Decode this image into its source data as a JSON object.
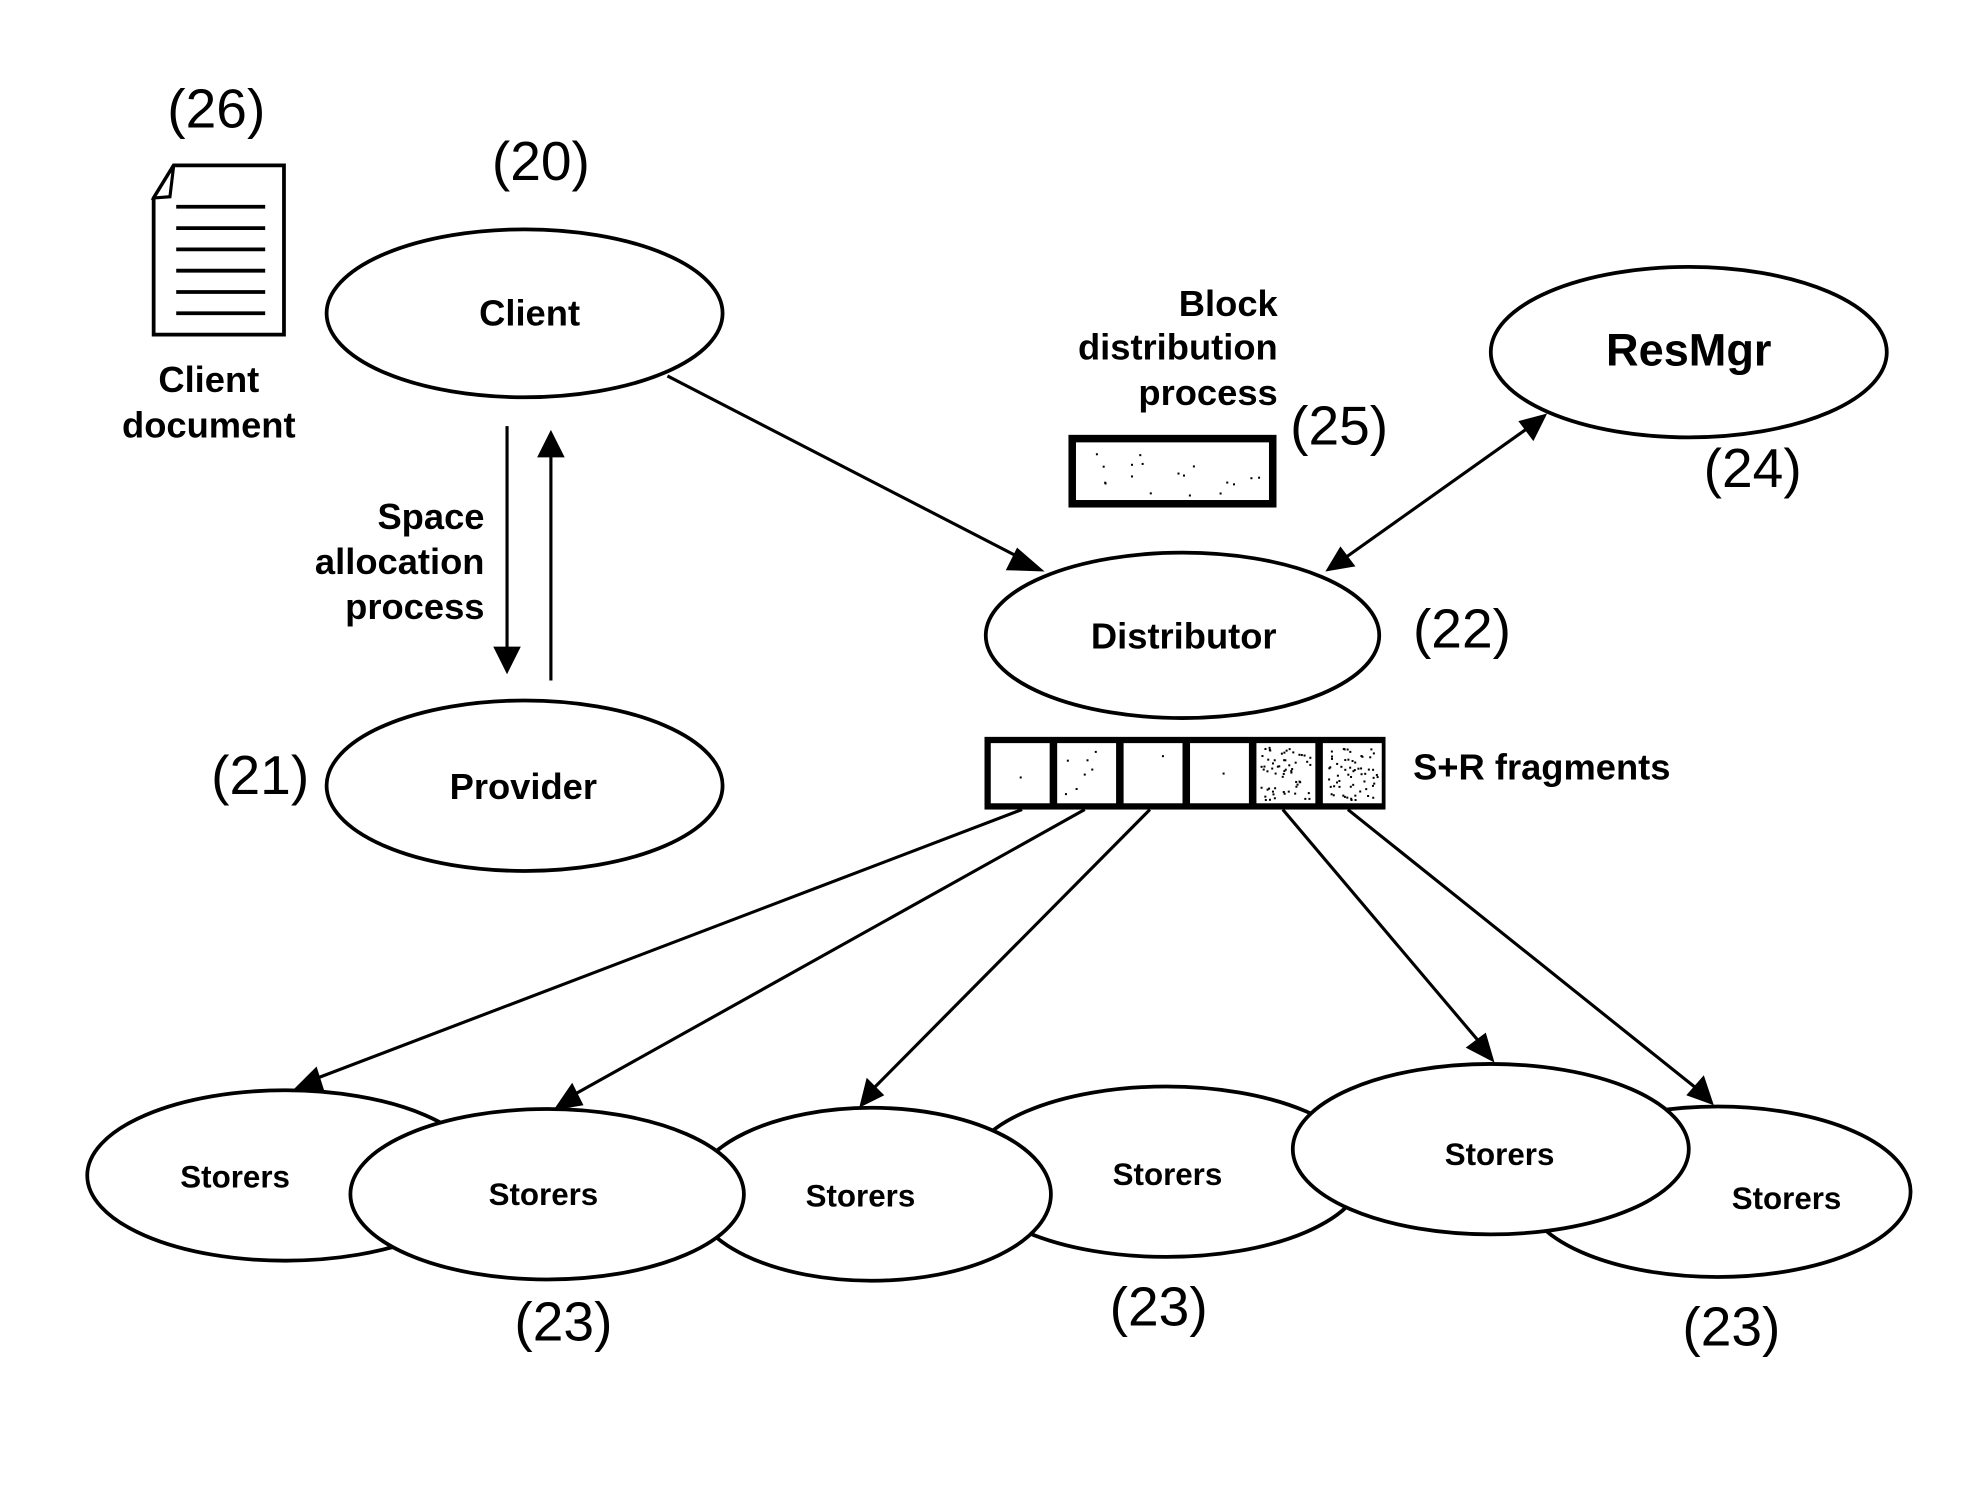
{
  "diagram": {
    "document": {
      "ref": "(26)",
      "label_lines": [
        "Client",
        "document"
      ]
    },
    "nodes": {
      "client": {
        "label": "Client",
        "ref": "(20)"
      },
      "provider": {
        "label": "Provider",
        "ref": "(21)"
      },
      "distributor": {
        "label": "Distributor",
        "ref": "(22)"
      },
      "resmgr": {
        "label": "ResMgr",
        "ref": "(24)"
      },
      "storers": [
        {
          "label": "Storers"
        },
        {
          "label": "Storers"
        },
        {
          "label": "Storers"
        },
        {
          "label": "Storers"
        },
        {
          "label": "Storers"
        },
        {
          "label": "Storers"
        }
      ],
      "storers_refs": [
        "(23)",
        "(23)",
        "(23)"
      ]
    },
    "space_allocation": {
      "label_lines": [
        "Space",
        "allocation",
        "process"
      ]
    },
    "block_distribution": {
      "label_lines": [
        "Block",
        "distribution",
        "process"
      ],
      "ref": "(25)"
    },
    "fragments": {
      "label": "S+R fragments",
      "cells": [
        {
          "kind": "plain"
        },
        {
          "kind": "sparse"
        },
        {
          "kind": "plain"
        },
        {
          "kind": "plain"
        },
        {
          "kind": "dense"
        },
        {
          "kind": "dense"
        }
      ]
    },
    "edges": [
      {
        "from": "client",
        "to": "provider",
        "label": "space-allocation-request"
      },
      {
        "from": "provider",
        "to": "client",
        "label": "space-allocation-response"
      },
      {
        "from": "client",
        "to": "distributor"
      },
      {
        "from": "distributor",
        "to": "resmgr",
        "bidirectional": true
      },
      {
        "from": "fragments",
        "to": "storers-1"
      },
      {
        "from": "fragments",
        "to": "storers-2"
      },
      {
        "from": "fragments",
        "to": "storers-3"
      },
      {
        "from": "fragments",
        "to": "storers-5"
      },
      {
        "from": "fragments",
        "to": "storers-6"
      }
    ]
  }
}
